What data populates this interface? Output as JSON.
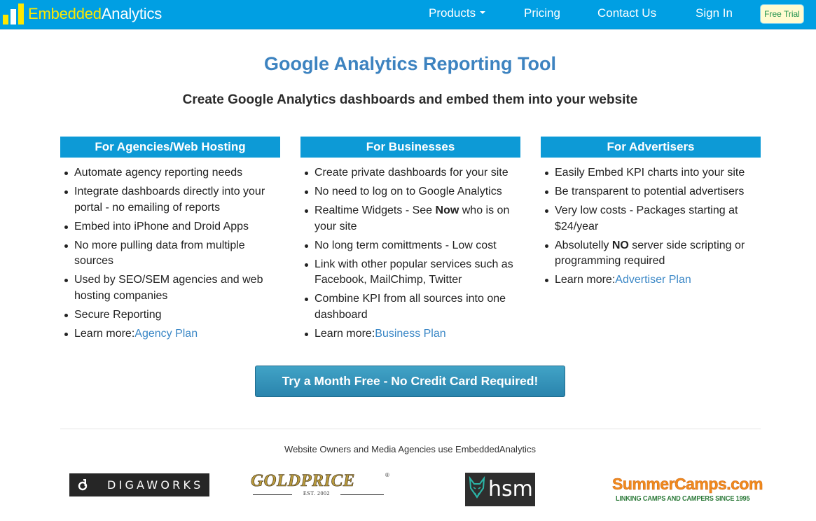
{
  "brand": {
    "name_part1": "Embedded",
    "name_part2": "Analytics",
    "logo_icon": "bar-chart-icon"
  },
  "nav": {
    "products": "Products",
    "pricing": "Pricing",
    "contact": "Contact Us",
    "signin": "Sign In",
    "free_trial": "Free Trial"
  },
  "page": {
    "title": "Google Analytics Reporting Tool",
    "subtitle": "Create Google Analytics dashboards and embed them into your website"
  },
  "columns": [
    {
      "heading": "For Agencies/Web Hosting",
      "items": [
        "Automate agency reporting needs",
        "Integrate dashboards directly into your portal - no emailing of reports",
        "Embed into iPhone and Droid Apps",
        "No more pulling data from multiple sources",
        "Used by SEO/SEM agencies and web hosting companies",
        "Secure Reporting"
      ],
      "learn_more_label": "Learn more:",
      "learn_more_link": "Agency Plan"
    },
    {
      "heading": "For Businesses",
      "items": [
        "Create private dashboards for your site",
        "No need to log on to Google Analytics",
        {
          "before": "Realtime Widgets - See ",
          "bold": "Now",
          "after": " who is on your site"
        },
        "No long term comittments - Low cost",
        "Link with other popular services such as Facebook, MailChimp, Twitter",
        "Combine KPI from all sources into one dashboard"
      ],
      "learn_more_label": "Learn more:",
      "learn_more_link": "Business Plan"
    },
    {
      "heading": "For Advertisers",
      "items": [
        "Easily Embed KPI charts into your site",
        "Be transparent to potential advertisers",
        "Very low costs - Packages starting at $24/year",
        {
          "before": "Absolutelly ",
          "bold": "NO",
          "after": " server side scripting or programming required"
        }
      ],
      "learn_more_label": "Learn more:",
      "learn_more_link": "Advertiser Plan"
    }
  ],
  "cta": {
    "label": "Try a Month Free - No Credit Card Required!"
  },
  "clients": {
    "caption": "Website Owners and Media Agencies use EmbeddedAnalytics",
    "logos": {
      "digaworks": "DIGAWORKS",
      "goldprice": "GOLDPRICE",
      "goldprice_reg": "®",
      "goldprice_est": "EST. 2002",
      "hsm": "hsm",
      "summercamps": "SummerCamps.com",
      "summercamps_tagline": "LINKING CAMPS AND CAMPERS SINCE 1995"
    }
  },
  "colors": {
    "navbar": "#009fe3",
    "title": "#3d83c0",
    "column_header": "#0d9ad6",
    "link": "#3a87c6",
    "cta": "#2a84ad"
  }
}
